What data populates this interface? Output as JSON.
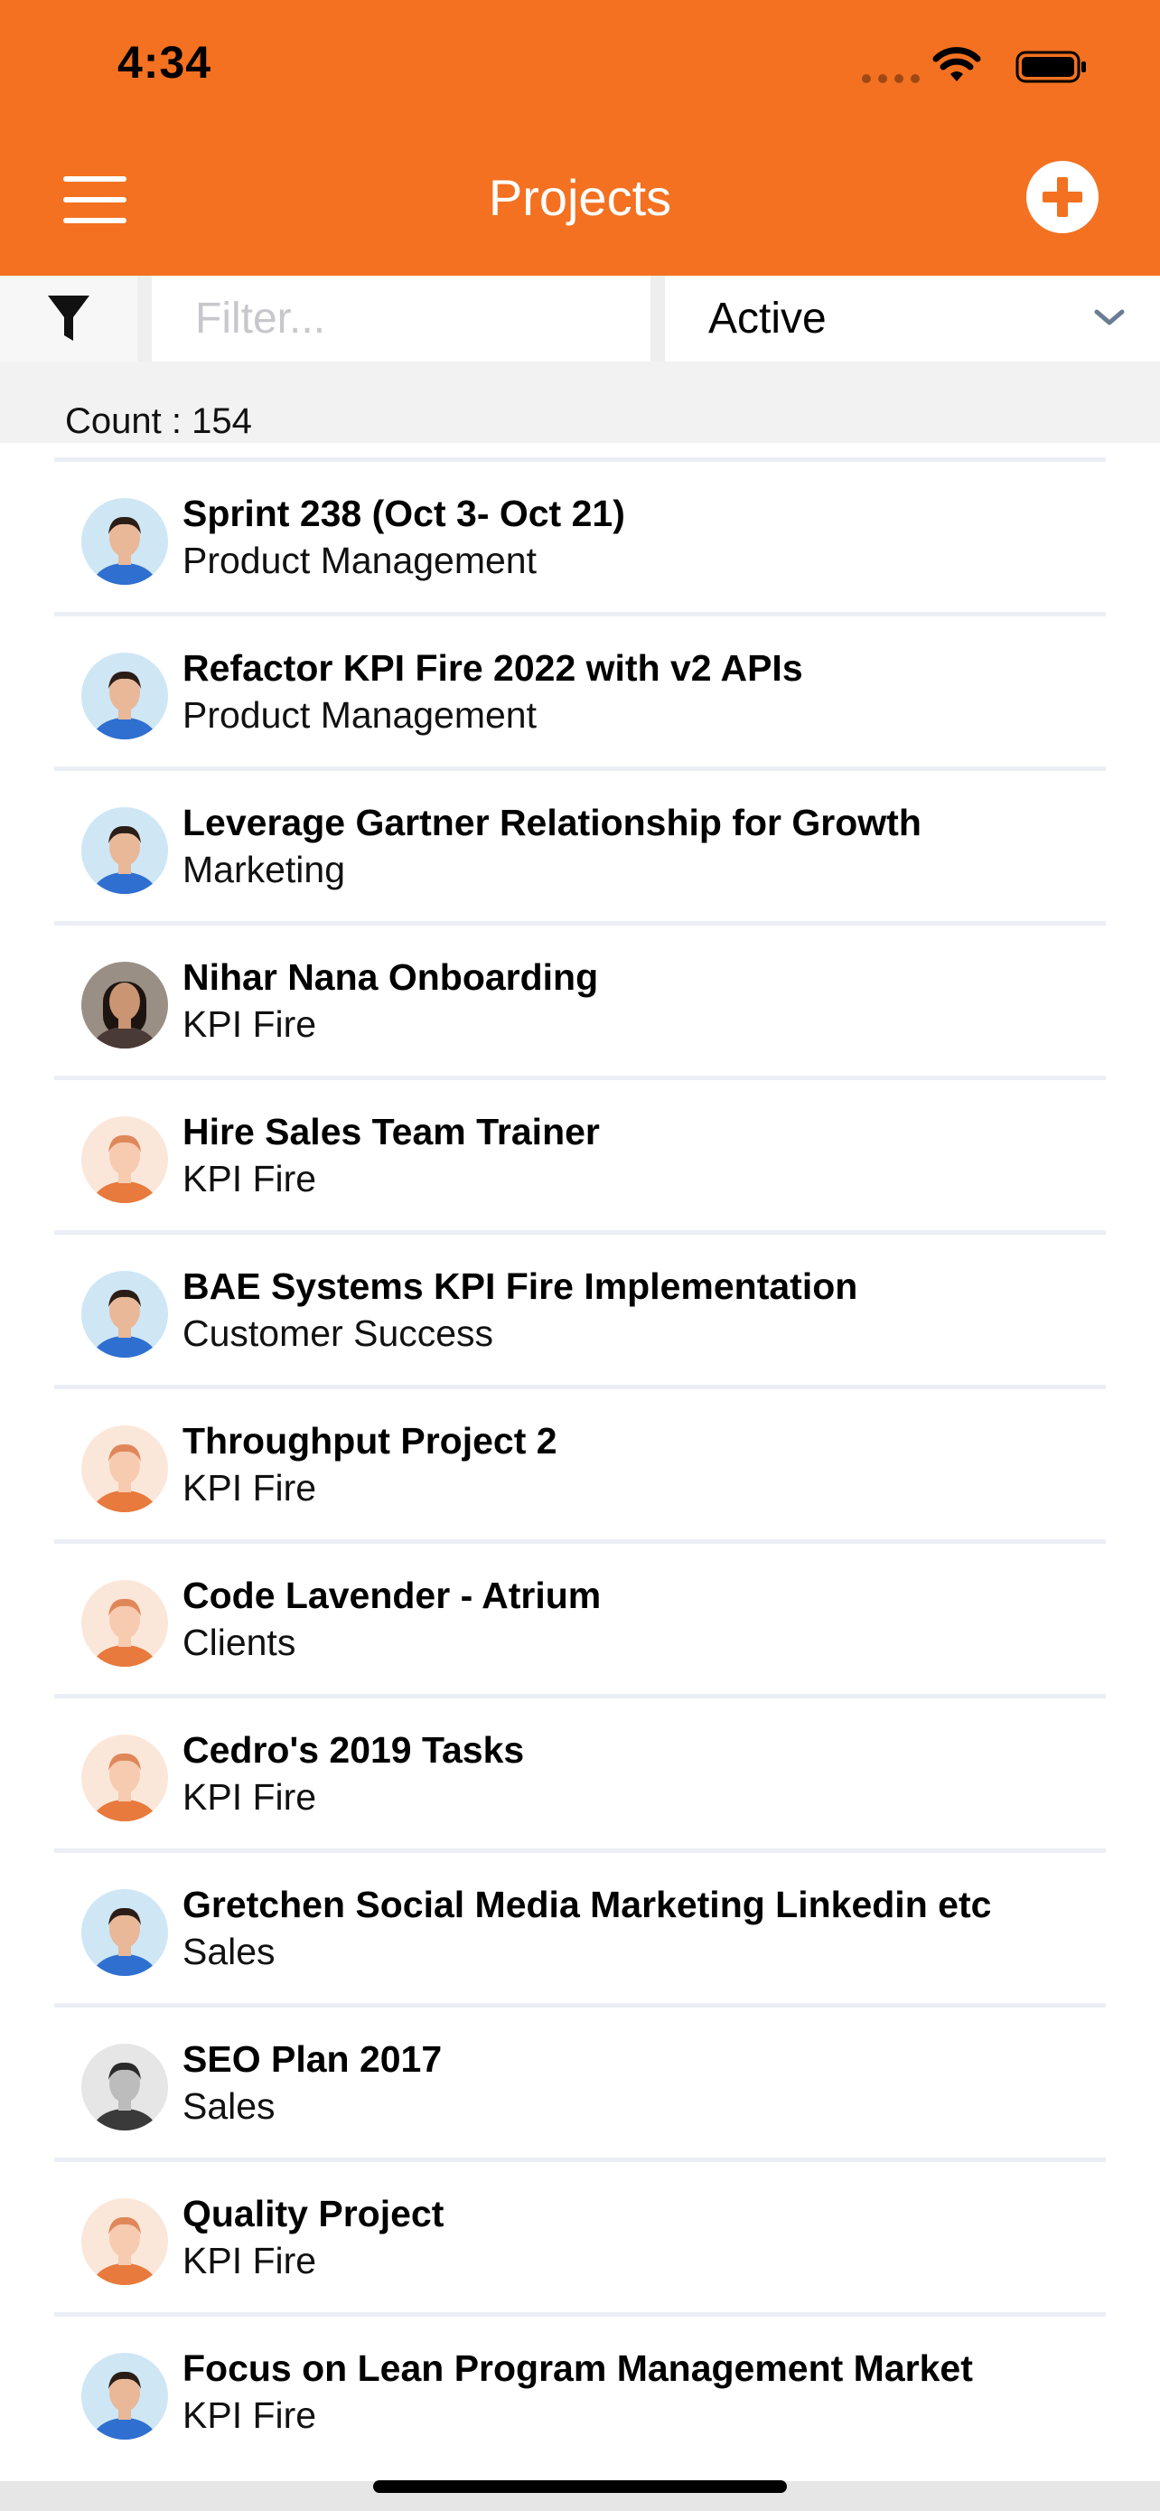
{
  "status_bar": {
    "time": "4:34"
  },
  "header": {
    "title": "Projects",
    "accent_color": "#f37121",
    "menu_icon": "hamburger-menu-icon",
    "add_icon": "plus-circle-icon"
  },
  "filter_bar": {
    "filter_icon": "funnel-filter-icon",
    "input_placeholder": "Filter...",
    "input_value": "",
    "status_selected": "Active",
    "dropdown_icon": "chevron-down-icon"
  },
  "count_label": "Count : 154",
  "projects": [
    {
      "title": "Sprint 238 (Oct 3- Oct  21)",
      "subtitle": "Product Management",
      "avatar": "blue"
    },
    {
      "title": "Refactor KPI Fire 2022 with v2 APIs",
      "subtitle": "Product Management",
      "avatar": "blue"
    },
    {
      "title": "Leverage Gartner Relationship for Growth",
      "subtitle": "Marketing",
      "avatar": "blue"
    },
    {
      "title": "Nihar Nana Onboarding",
      "subtitle": "KPI Fire",
      "avatar": "woman"
    },
    {
      "title": "Hire Sales Team Trainer",
      "subtitle": "KPI Fire",
      "avatar": "orange"
    },
    {
      "title": "BAE Systems KPI Fire Implementation",
      "subtitle": "Customer Success",
      "avatar": "blue"
    },
    {
      "title": "Throughput Project 2",
      "subtitle": "KPI Fire",
      "avatar": "orange"
    },
    {
      "title": "Code Lavender - Atrium",
      "subtitle": "Clients",
      "avatar": "orange"
    },
    {
      "title": "Cedro's 2019 Tasks",
      "subtitle": "KPI Fire",
      "avatar": "orange"
    },
    {
      "title": "Gretchen Social Media Marketing Linkedin etc",
      "subtitle": "Sales",
      "avatar": "blue"
    },
    {
      "title": "SEO Plan 2017",
      "subtitle": "Sales",
      "avatar": "gray"
    },
    {
      "title": "Quality Project",
      "subtitle": "KPI Fire",
      "avatar": "orange"
    },
    {
      "title": "Focus on Lean Program Management  Market",
      "subtitle": "KPI Fire",
      "avatar": "blue"
    }
  ]
}
